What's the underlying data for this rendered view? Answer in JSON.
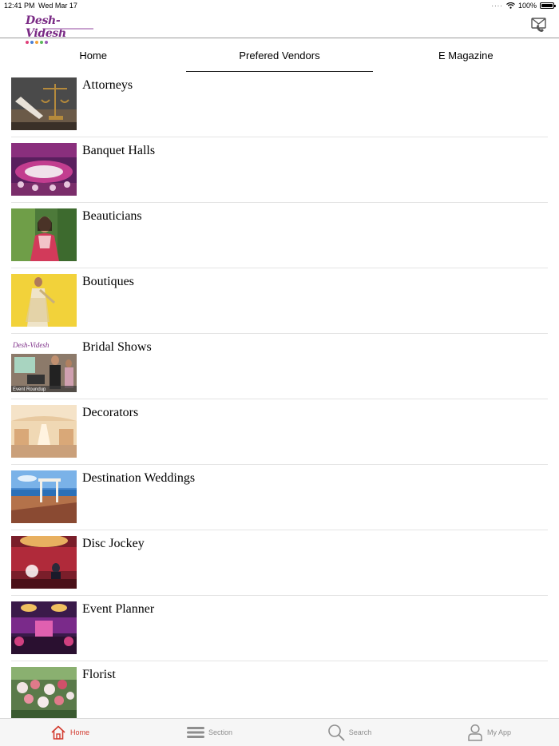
{
  "status": {
    "time": "12:41 PM",
    "date": "Wed Mar 17",
    "battery": "100%"
  },
  "header": {
    "logo_text": "Desh-Videsh"
  },
  "tabs": [
    {
      "label": "Home",
      "active": false
    },
    {
      "label": "Prefered Vendors",
      "active": true
    },
    {
      "label": "E Magazine",
      "active": false
    }
  ],
  "vendors": [
    {
      "name": "Attorneys"
    },
    {
      "name": "Banquet Halls"
    },
    {
      "name": "Beauticians"
    },
    {
      "name": "Boutiques"
    },
    {
      "name": "Bridal Shows",
      "thumb_caption": "Event Roundup"
    },
    {
      "name": "Decorators"
    },
    {
      "name": "Destination Weddings"
    },
    {
      "name": "Disc Jockey"
    },
    {
      "name": "Event Planner"
    },
    {
      "name": "Florist"
    }
  ],
  "bottom_nav": [
    {
      "label": "Home",
      "icon": "home-icon",
      "active": true
    },
    {
      "label": "Section",
      "icon": "menu-icon",
      "active": false
    },
    {
      "label": "Search",
      "icon": "search-icon",
      "active": false
    },
    {
      "label": "My App",
      "icon": "user-icon",
      "active": false
    }
  ],
  "colors": {
    "active_nav": "#d23a2e",
    "inactive_nav": "#8e8e8e",
    "logo": "#7a2a85"
  }
}
